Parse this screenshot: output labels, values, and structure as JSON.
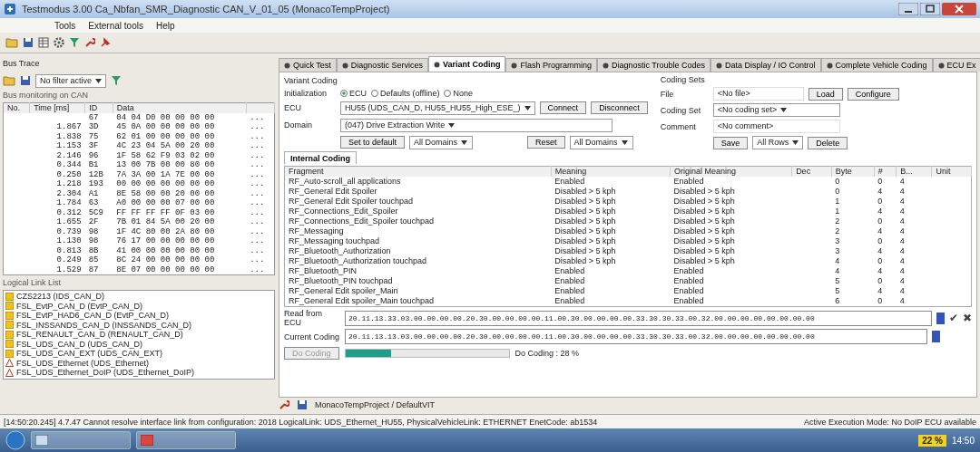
{
  "window": {
    "title": "Testmodus 3.00 Ca_Nbfan_SMR_Diagnostic CAN_V_01_05 (MonacoTempProject)"
  },
  "menu": [
    "Tools",
    "External tools",
    "Help"
  ],
  "trace": {
    "title": "Bus Trace",
    "filter": "No filter active",
    "caption": "Bus monitoring on CAN",
    "columns": [
      "No.",
      "Time [ms]",
      "ID",
      "Data"
    ],
    "rows": [
      [
        "",
        "",
        "67",
        "04 04 D0 00 00 00 00",
        "..."
      ],
      [
        "",
        "1.867",
        "3D",
        "45 0A 00 00 00 00 00",
        "..."
      ],
      [
        "",
        "1.838",
        "75",
        "62 01 00 00 00 00 00",
        "..."
      ],
      [
        "",
        "1.153",
        "3F",
        "4C 23 04 5A 00 20 00",
        "..."
      ],
      [
        "",
        "2.146",
        "96",
        "1F 58 62 F9 03 02 00",
        "..."
      ],
      [
        "",
        "0.344",
        "B1",
        "13 00 7B 00 00 80 00",
        "..."
      ],
      [
        "",
        "0.250",
        "12B",
        "7A 3A 00 1A 7E 00 00",
        "..."
      ],
      [
        "",
        "1.218",
        "193",
        "00 00 00 00 00 00 00",
        "..."
      ],
      [
        "",
        "2.304",
        "A1",
        "8E 58 00 00 20 00 00",
        "..."
      ],
      [
        "",
        "1.784",
        "63",
        "A0 00 00 00 07 00 00",
        "..."
      ],
      [
        "",
        "0.312",
        "5C9",
        "FF FF FF FF 0F 03 00",
        "..."
      ],
      [
        "",
        "1.655",
        "2F",
        "7B 01 84 5A 00 20 00",
        "..."
      ],
      [
        "",
        "0.739",
        "98",
        "1F 4C 80 00 2A 80 00",
        "..."
      ],
      [
        "",
        "1.130",
        "98",
        "76 17 00 00 00 00 00",
        "..."
      ],
      [
        "",
        "0.813",
        "8B",
        "41 00 00 00 00 00 00",
        "..."
      ],
      [
        "",
        "0.249",
        "85",
        "8C 24 00 00 00 00 00",
        "..."
      ],
      [
        "",
        "1.529",
        "87",
        "8E 07 00 00 00 00 00",
        "..."
      ]
    ]
  },
  "logical_links": {
    "title": "Logical Link List",
    "items": [
      {
        "kind": "ok",
        "label": "CZS2213 (IDS_CAN_D)"
      },
      {
        "kind": "ok",
        "label": "FSL_EvtP_CAN_D (EvtP_CAN_D)"
      },
      {
        "kind": "ok",
        "label": "FSL_EvtP_HAD6_CAN_D (EvtP_CAN_D)"
      },
      {
        "kind": "ok",
        "label": "FSL_INSSANDS_CAN_D (INSSANDS_CAN_D)"
      },
      {
        "kind": "ok",
        "label": "FSL_RENAULT_CAN_D (RENAULT_CAN_D)"
      },
      {
        "kind": "ok",
        "label": "FSL_UDS_CAN_D (UDS_CAN_D)"
      },
      {
        "kind": "ok",
        "label": "FSL_UDS_CAN_EXT (UDS_CAN_EXT)"
      },
      {
        "kind": "warning",
        "label": "FSL_UDS_Ethernet (UDS_Ethernet)"
      },
      {
        "kind": "warning",
        "label": "FSL_UDS_Ethernet_DoIP (UDS_Ethernet_DoIP)"
      }
    ]
  },
  "tabs": [
    {
      "label": "Quick Test",
      "selected": false
    },
    {
      "label": "Diagnostic Services",
      "selected": false
    },
    {
      "label": "Variant Coding",
      "selected": true
    },
    {
      "label": "Flash Programming",
      "selected": false
    },
    {
      "label": "Diagnostic Trouble Codes",
      "selected": false
    },
    {
      "label": "Data Display / IO Control",
      "selected": false
    },
    {
      "label": "Complete Vehicle Coding",
      "selected": false
    },
    {
      "label": "ECU Ex",
      "selected": false
    }
  ],
  "variant_coding": {
    "title": "Variant Coding",
    "init_label": "Initialization",
    "init_options": [
      {
        "label": "ECU",
        "selected": true
      },
      {
        "label": "Defaults (offline)",
        "selected": false
      },
      {
        "label": "None",
        "selected": false
      }
    ],
    "ecu_label": "ECU",
    "ecu": "HU55 (UDS_CAN_D, HU55_HU55_High_ESE_)",
    "connect": "Connect",
    "disconnect": "Disconnect",
    "domain_label": "Domain",
    "domain": "(047) Drive Extraction Write",
    "set_default": "Set to default",
    "domains_left": "All Domains",
    "reset": "Reset",
    "domains_right": "All Domains"
  },
  "coding_sets": {
    "title": "Coding Sets",
    "file_label": "File",
    "file": "<No file>",
    "load": "Load",
    "configure": "Configure",
    "set_label": "Coding Set",
    "set": "<No coding set>",
    "comment_label": "Comment",
    "comment": "<No comment>",
    "save": "Save",
    "rows": "All Rows",
    "delete": "Delete"
  },
  "subtab": {
    "label": "Internal Coding",
    "selected": true
  },
  "coding_table": {
    "columns": [
      "Fragment",
      "Meaning",
      "Original Meaning",
      "Dec",
      "Byte",
      "#",
      "B...",
      "Unit"
    ],
    "rows": [
      [
        "RF_Auto-scroll_all applications",
        "Enabled",
        "Enabled",
        "",
        "0",
        "0",
        "4",
        ""
      ],
      [
        "RF_General Edit Spoiler",
        "Disabled > 5 kph",
        "Disabled > 5 kph",
        "",
        "0",
        "4",
        "4",
        ""
      ],
      [
        "RF_General Edit Spoiler touchpad",
        "Disabled > 5 kph",
        "Disabled > 5 kph",
        "",
        "1",
        "0",
        "4",
        ""
      ],
      [
        "RF_Connections_Edit_Spoiler",
        "Disabled > 5 kph",
        "Disabled > 5 kph",
        "",
        "1",
        "4",
        "4",
        ""
      ],
      [
        "RF_Connections_Edit_Spoiler touchpad",
        "Disabled > 5 kph",
        "Disabled > 5 kph",
        "",
        "2",
        "0",
        "4",
        ""
      ],
      [
        "RF_Messaging",
        "Disabled > 5 kph",
        "Disabled > 5 kph",
        "",
        "2",
        "4",
        "4",
        ""
      ],
      [
        "RF_Messaging touchpad",
        "Disabled > 5 kph",
        "Disabled > 5 kph",
        "",
        "3",
        "0",
        "4",
        ""
      ],
      [
        "RF_Bluetooth_Authorization",
        "Disabled > 5 kph",
        "Disabled > 5 kph",
        "",
        "3",
        "4",
        "4",
        ""
      ],
      [
        "RF_Bluetooth_Authorization touchpad",
        "Disabled > 5 kph",
        "Disabled > 5 kph",
        "",
        "4",
        "0",
        "4",
        ""
      ],
      [
        "RF_Bluetooth_PIN",
        "Enabled",
        "Enabled",
        "",
        "4",
        "4",
        "4",
        ""
      ],
      [
        "RF_Bluetooth_PIN touchpad",
        "Enabled",
        "Enabled",
        "",
        "5",
        "0",
        "4",
        ""
      ],
      [
        "RF_General Edit spoiler_Main",
        "Enabled",
        "Enabled",
        "",
        "5",
        "4",
        "4",
        ""
      ],
      [
        "RF_General Edit spoiler_Main touchpad",
        "Enabled",
        "Enabled",
        "",
        "6",
        "0",
        "4",
        ""
      ]
    ]
  },
  "read_from_ecu": {
    "label": "Read from ECU",
    "value": "20.11.13.33.03.00.00.00.00.20.30.00.00.00.00.11.00.30.00.00.00.00.33.30.30.33.00.32.00.00.00.00.00.00.00.00"
  },
  "current_coding": {
    "label": "Current Coding",
    "value": "20.11.13.13.03.00.00.00.00.20.30.00.00.00.00.11.00.30.00.00.00.00.33.30.30.33.00.32.00.00.00.00.00.00.00.00"
  },
  "accept": "✔",
  "reject": "✖",
  "do_coding": {
    "label": "Do Coding",
    "disabled": true,
    "level": 0.28,
    "status": "Do Coding : 28 %"
  },
  "project": "MonacoTempProject / DefaultVIT",
  "status_bar": {
    "message": "[14:50:20.245] 4.7.47 Cannot resolve interface link from configuration: 2018 LogicalLink: UDS_Ethernet_HU55, PhysicalVehicleLink: ETHERNET EnetCode: ab1534",
    "mode": "Active Execution Mode: No DoIP ECU available"
  },
  "tray": {
    "badge": "22 %",
    "clock": "14:50"
  }
}
